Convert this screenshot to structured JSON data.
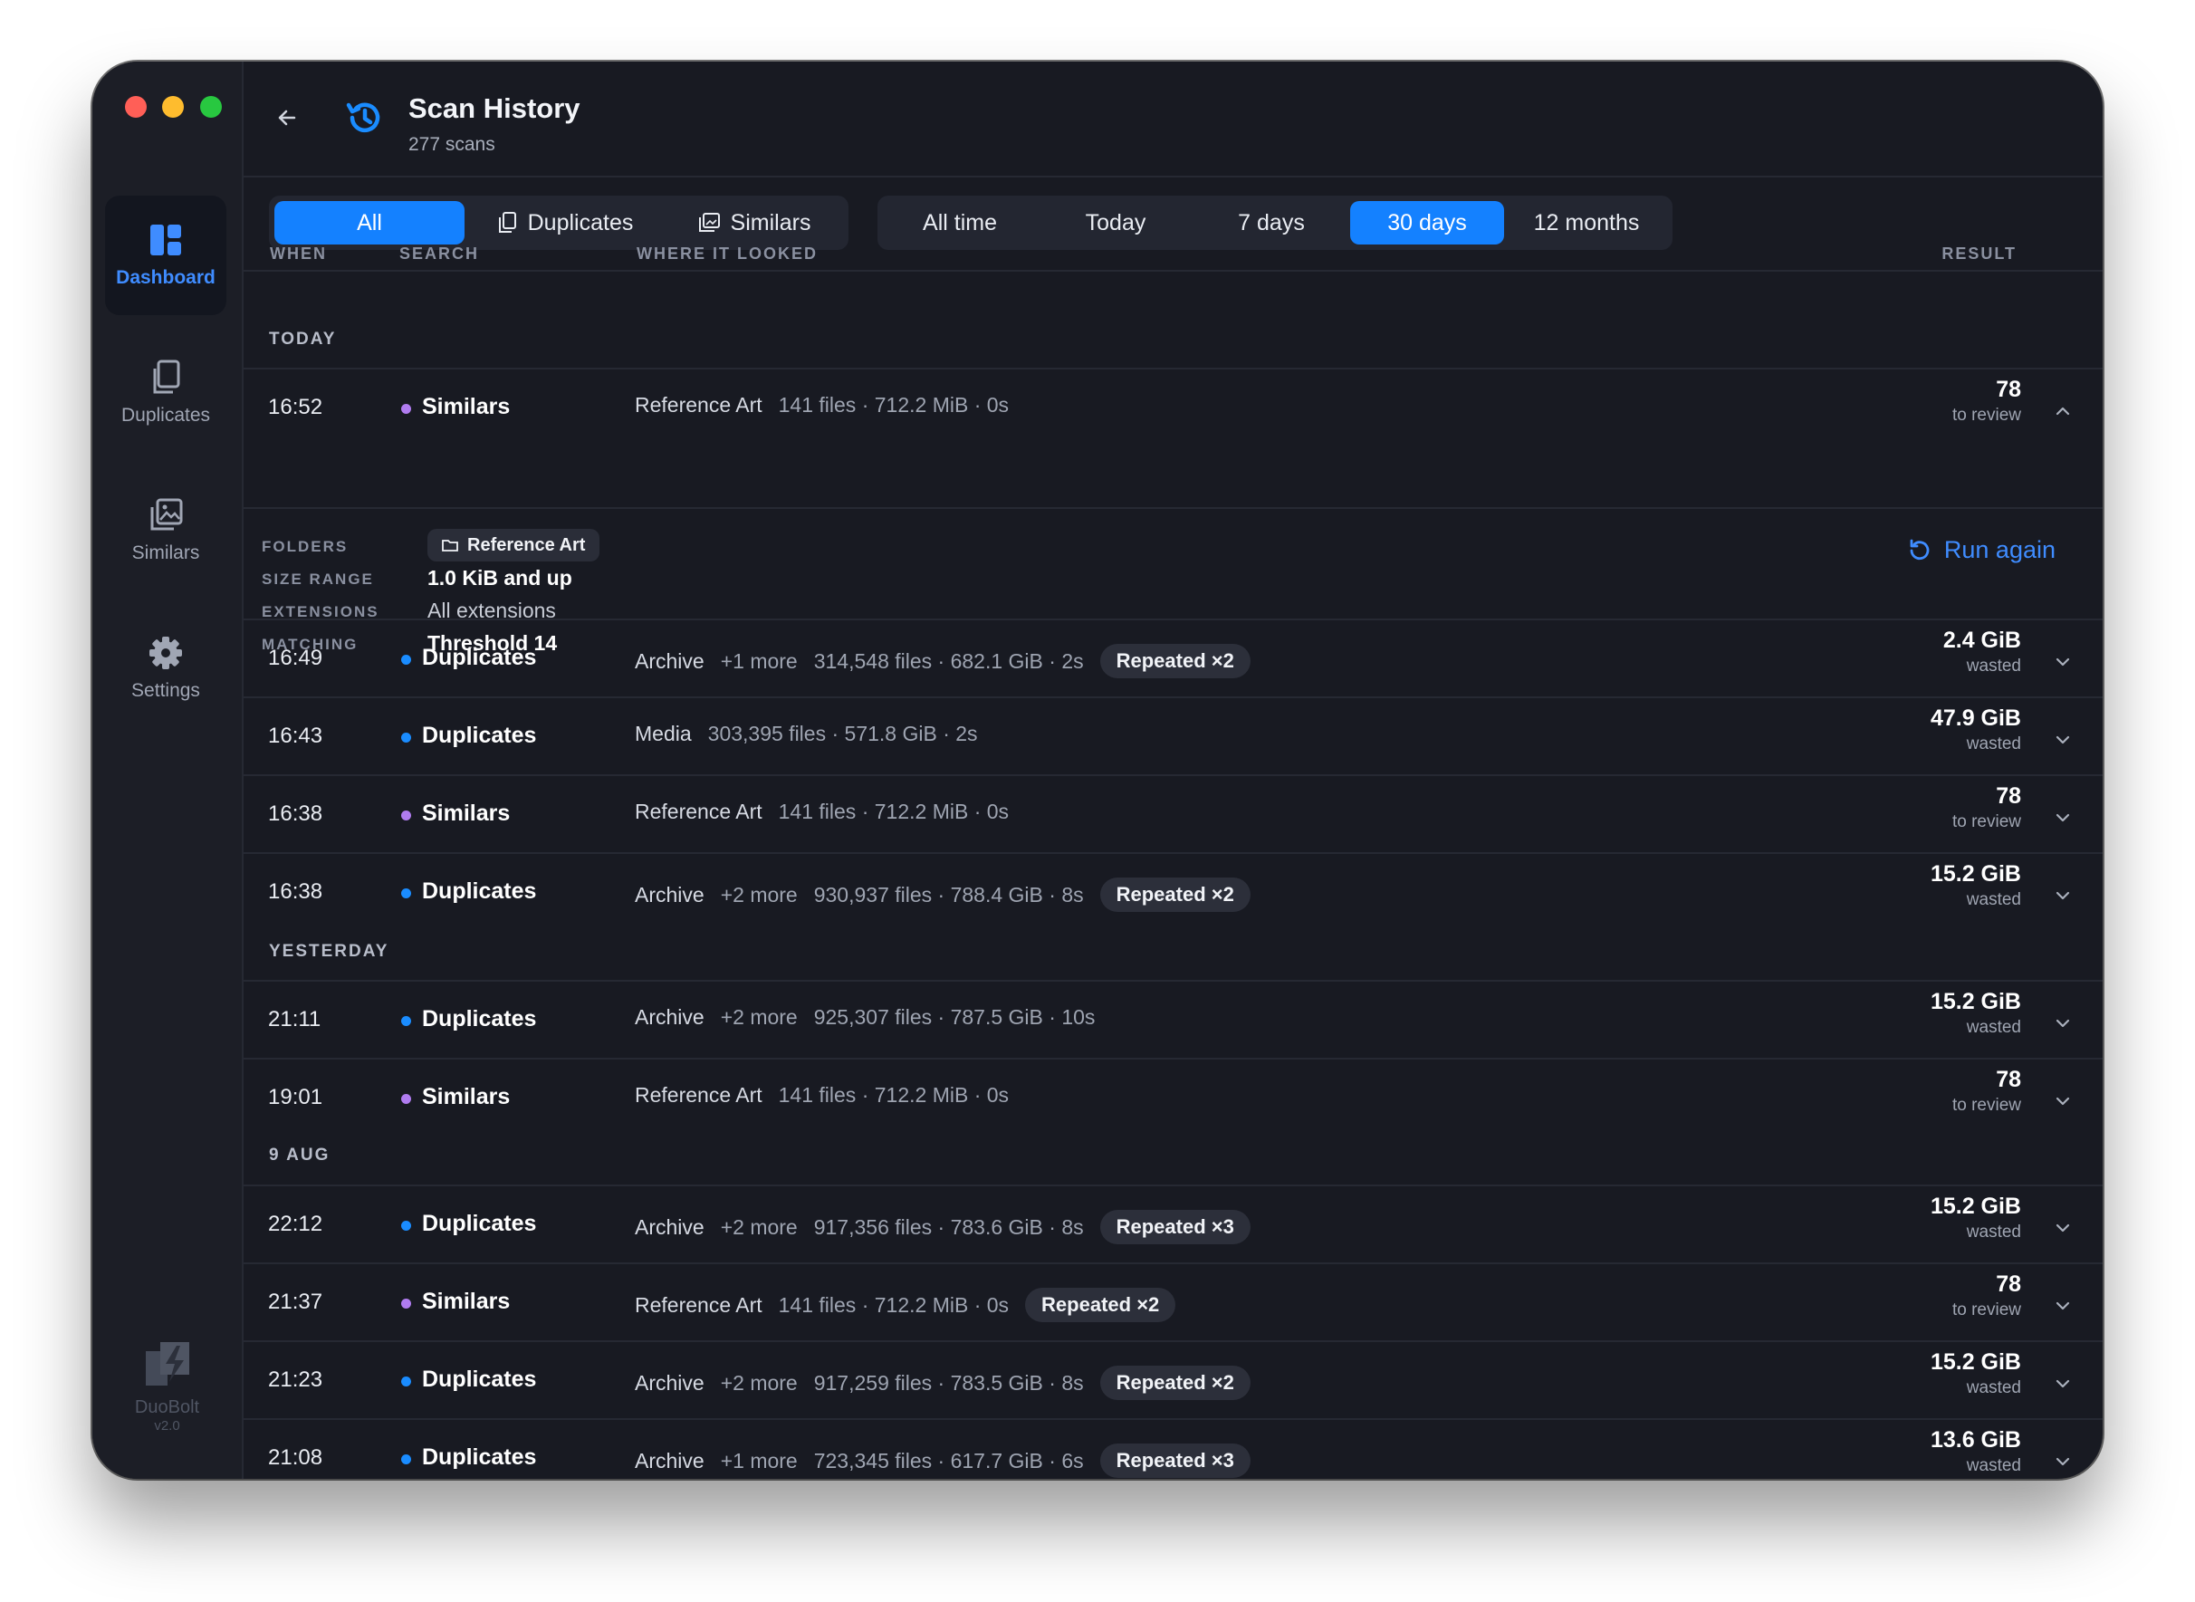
{
  "sidebar": {
    "items": [
      {
        "label": "Dashboard",
        "icon": "dashboard-icon",
        "active": true
      },
      {
        "label": "Duplicates",
        "icon": "duplicates-icon"
      },
      {
        "label": "Similars",
        "icon": "similars-icon"
      },
      {
        "label": "Settings",
        "icon": "gear-icon"
      }
    ],
    "brand": {
      "name": "DuoBolt",
      "version": "v2.0"
    }
  },
  "header": {
    "title": "Scan History",
    "subtitle": "277 scans"
  },
  "filters": {
    "type": [
      {
        "label": "All",
        "active": true
      },
      {
        "label": "Duplicates",
        "icon": "duplicates-icon"
      },
      {
        "label": "Similars",
        "icon": "similars-icon"
      }
    ],
    "range": [
      {
        "label": "All time"
      },
      {
        "label": "Today"
      },
      {
        "label": "7 days"
      },
      {
        "label": "30 days",
        "active": true
      },
      {
        "label": "12 months"
      }
    ]
  },
  "columns": {
    "when": "WHEN",
    "search": "SEARCH",
    "where": "WHERE IT LOOKED",
    "result": "RESULT"
  },
  "sections": {
    "today": "TODAY",
    "yesterday": "YESTERDAY",
    "aug9": "9 AUG"
  },
  "rows": [
    {
      "time": "16:52",
      "type": "Similars",
      "location": "Reference Art",
      "more": "",
      "meta": "141 files · 712.2 MiB · 0s",
      "badge": "",
      "result": "78",
      "result_label": "to review",
      "expanded": true
    },
    {
      "time": "16:49",
      "type": "Duplicates",
      "location": "Archive",
      "more": "+1 more",
      "meta": "314,548 files · 682.1 GiB · 2s",
      "badge": "Repeated ×2",
      "result": "2.4 GiB",
      "result_label": "wasted"
    },
    {
      "time": "16:43",
      "type": "Duplicates",
      "location": "Media",
      "more": "",
      "meta": "303,395 files · 571.8 GiB · 2s",
      "badge": "",
      "result": "47.9 GiB",
      "result_label": "wasted"
    },
    {
      "time": "16:38",
      "type": "Similars",
      "location": "Reference Art",
      "more": "",
      "meta": "141 files · 712.2 MiB · 0s",
      "badge": "",
      "result": "78",
      "result_label": "to review"
    },
    {
      "time": "16:38",
      "type": "Duplicates",
      "location": "Archive",
      "more": "+2 more",
      "meta": "930,937 files · 788.4 GiB · 8s",
      "badge": "Repeated ×2",
      "result": "15.2 GiB",
      "result_label": "wasted"
    },
    {
      "time": "21:11",
      "type": "Duplicates",
      "location": "Archive",
      "more": "+2 more",
      "meta": "925,307 files · 787.5 GiB · 10s",
      "badge": "",
      "result": "15.2 GiB",
      "result_label": "wasted"
    },
    {
      "time": "19:01",
      "type": "Similars",
      "location": "Reference Art",
      "more": "",
      "meta": "141 files · 712.2 MiB · 0s",
      "badge": "",
      "result": "78",
      "result_label": "to review"
    },
    {
      "time": "22:12",
      "type": "Duplicates",
      "location": "Archive",
      "more": "+2 more",
      "meta": "917,356 files · 783.6 GiB · 8s",
      "badge": "Repeated ×3",
      "result": "15.2 GiB",
      "result_label": "wasted"
    },
    {
      "time": "21:37",
      "type": "Similars",
      "location": "Reference Art",
      "more": "",
      "meta": "141 files · 712.2 MiB · 0s",
      "badge": "Repeated ×2",
      "result": "78",
      "result_label": "to review"
    },
    {
      "time": "21:23",
      "type": "Duplicates",
      "location": "Archive",
      "more": "+2 more",
      "meta": "917,259 files · 783.5 GiB · 8s",
      "badge": "Repeated ×2",
      "result": "15.2 GiB",
      "result_label": "wasted"
    },
    {
      "time": "21:08",
      "type": "Duplicates",
      "location": "Archive",
      "more": "+1 more",
      "meta": "723,345 files · 617.7 GiB · 6s",
      "badge": "Repeated ×3",
      "result": "13.6 GiB",
      "result_label": "wasted"
    }
  ],
  "details": {
    "folders_label": "FOLDERS",
    "folders": "Reference Art",
    "size_label": "SIZE RANGE",
    "size": "1.0 KiB and up",
    "ext_label": "EXTENSIONS",
    "ext": "All extensions",
    "match_label": "MATCHING",
    "match": "Threshold 14",
    "run_again": "Run again"
  },
  "colors": {
    "accent": "#1481ff",
    "duplicates_dot": "#1a8cff",
    "similars_dot": "#b07cf0",
    "background": "#181a22"
  }
}
